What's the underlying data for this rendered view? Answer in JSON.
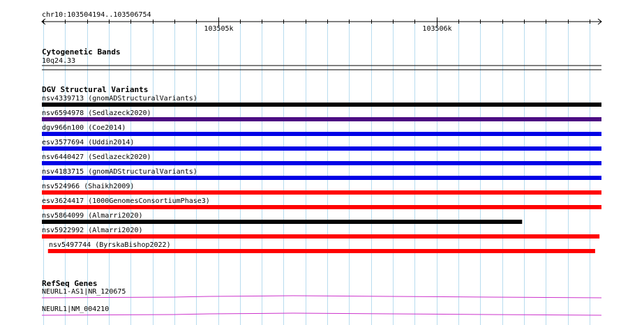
{
  "ruler": {
    "region_label": "chr10:103504194..103506754",
    "start": 103504194,
    "end": 103506754,
    "major_ticks": [
      {
        "pos": 103505000,
        "label": "103505k"
      },
      {
        "pos": 103506000,
        "label": "103506k"
      }
    ],
    "minor_step": 100
  },
  "cytobands": {
    "title": "Cytogenetic Bands",
    "band_label": "10q24.33"
  },
  "dgv": {
    "title": "DGV Structural Variants",
    "variants": [
      {
        "label": "nsv4339713 (gnomADStructuralVariants)",
        "start": 103504194,
        "end": 103506754,
        "color": "#000000"
      },
      {
        "label": "nsv6594978 (Sedlazeck2020)",
        "start": 103504194,
        "end": 103506754,
        "color": "#4b0b82"
      },
      {
        "label": "dgv966n100 (Coe2014)",
        "start": 103504194,
        "end": 103506754,
        "color": "#0000e6"
      },
      {
        "label": "esv3577694 (Uddin2014)",
        "start": 103504194,
        "end": 103506754,
        "color": "#0000e6"
      },
      {
        "label": "nsv6440427 (Sedlazeck2020)",
        "start": 103504194,
        "end": 103506754,
        "color": "#0000e6"
      },
      {
        "label": "nsv4183715 (gnomADStructuralVariants)",
        "start": 103504194,
        "end": 103506754,
        "color": "#0000e6"
      },
      {
        "label": "nsv524966 (Shaikh2009)",
        "start": 103504194,
        "end": 103506754,
        "color": "#ff0000"
      },
      {
        "label": "esv3624417 (1000GenomesConsortiumPhase3)",
        "start": 103504194,
        "end": 103506754,
        "color": "#ff0000"
      },
      {
        "label": "nsv5864099 (Almarri2020)",
        "start": 103504194,
        "end": 103506391,
        "color": "#000000"
      },
      {
        "label": "nsv5922992 (Almarri2020)",
        "start": 103504194,
        "end": 103506745,
        "color": "#ff0000"
      },
      {
        "label": "nsv5497744 (ByrskaBishop2022)",
        "start": 103504222,
        "end": 103506725,
        "color": "#ff0000"
      }
    ]
  },
  "refseq": {
    "title": "RefSeq Genes",
    "genes": [
      {
        "label": "NEURL1-AS1|NR_120675",
        "color": "#cc33cc"
      },
      {
        "label": "NEURL1|NM_004210",
        "color": "#cc33cc"
      }
    ]
  },
  "colors": {
    "grid": "#b8dcef",
    "ruler": "#000000",
    "divider": "#000000"
  }
}
